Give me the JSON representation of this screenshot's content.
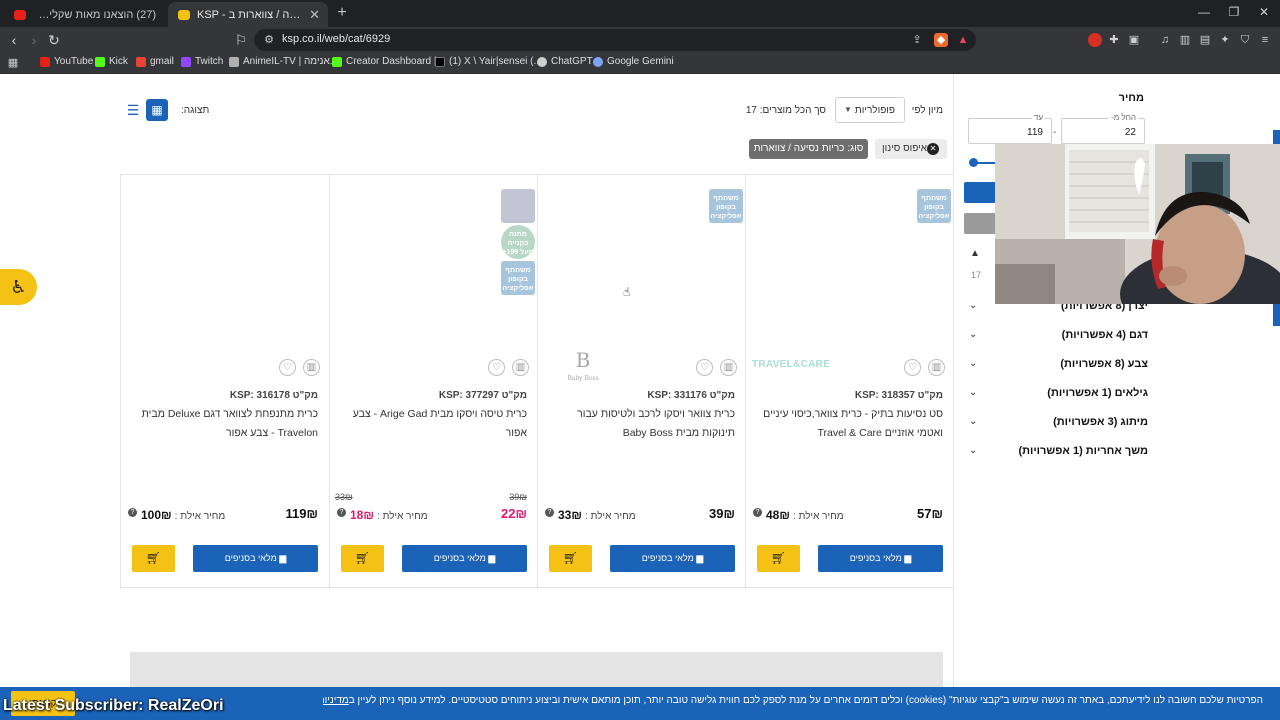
{
  "tabs": [
    {
      "title": "(27) הוצאנו מאות שקלים לבדוק מוצר...",
      "favicon": "youtube-icon",
      "active": false
    },
    {
      "title": "KSP - כריות נסיעה / צווארות ב-",
      "favicon": "ksp-icon",
      "active": true
    }
  ],
  "address_bar": {
    "url": "ksp.co.il/web/cat/6929"
  },
  "bookmarks": [
    {
      "label": "YouTube",
      "icon": "youtube-icon"
    },
    {
      "label": "Kick",
      "icon": "kick-icon"
    },
    {
      "label": "gmail",
      "icon": "gmail-icon"
    },
    {
      "label": "Twitch",
      "icon": "twitch-icon"
    },
    {
      "label": "AnimeIL-TV | אנימה...",
      "icon": "animeil-icon"
    },
    {
      "label": "Creator Dashboard |...",
      "icon": "kick-icon"
    },
    {
      "label": "(1) X \\ Yair|sensei (...",
      "icon": "x-icon"
    },
    {
      "label": "ChatGPT",
      "icon": "chatgpt-icon"
    },
    {
      "label": "Google Gemini",
      "icon": "gemini-icon"
    }
  ],
  "sidebar": {
    "price_title": "מחיר",
    "price_from_label": "החל מ-",
    "price_from_value": "22",
    "price_to_label": "עד",
    "price_to_value": "119",
    "range_dash": "-",
    "count": "17",
    "filters": [
      {
        "label": "יצרן (8 אפשרויות)"
      },
      {
        "label": "דגם (4 אפשרויות)"
      },
      {
        "label": "צבע (8 אפשרויות)"
      },
      {
        "label": "גילאים (1 אפשרויות)"
      },
      {
        "label": "מיתוג (3 אפשרויות)"
      },
      {
        "label": "משך אחריות (1 אפשרויות)"
      }
    ]
  },
  "toolbar": {
    "sort_label": "מיון לפי",
    "sort_value": "פופולריות",
    "total_label": "סך הכל מוצרים: 17",
    "display_label": "תצוגה:",
    "reset_label": "איפוס סינון",
    "active_filter_chip": "סוג: כריות נסיעה / צווארות"
  },
  "products": [
    {
      "sku": "מק\"ט KSP: 318357",
      "name": "סט נסיעות בתיק - כרית צוואר,כיסוי עיניים ואטמי אוזניים Travel & Care",
      "price": "57₪",
      "club_label": "מחיר אילת :",
      "club_price": "48₪",
      "brand_logo": "TRAVEL&CARE",
      "badges": [
        "משתתף בקופון אפליקציה"
      ]
    },
    {
      "sku": "מק\"ט KSP: 331176",
      "name": "כרית צוואר ויסקו לרכב ולטיסות עבור תינוקות מבית Baby Boss",
      "price": "39₪",
      "club_label": "מחיר אילת :",
      "club_price": "33₪",
      "brand_logo": "Baby Boss",
      "badges": [
        "משתתף בקופון אפליקציה"
      ]
    },
    {
      "sku": "מק\"ט KSP: 377297",
      "name": "כרית טיסה ויסקו מבית Arige Gad - צבע אפור",
      "price": "22₪",
      "old_price": "39₪",
      "club_label": "מחיר אילת :",
      "club_price": "18₪",
      "club_old_price": "33₪",
      "sale": true,
      "badges": [
        "",
        "מתנה בקנייה מעל 199+",
        "משתתף בקופון אפליקציה"
      ]
    },
    {
      "sku": "מק\"ט KSP: 316178",
      "name": "כרית מתנפחת לצוואר דגם Deluxe מבית Travelon - צבע אפור",
      "price": "119₪",
      "club_label": "מחיר אילת :",
      "club_price": "100₪",
      "badges": []
    }
  ],
  "buttons": {
    "in_stock_label": "מלאי בסניפים"
  },
  "cookie_bar": {
    "text": "הפרטיות שלכם חשובה לנו לידיעתכם, באתר זה נעשה שימוש ב\"קבצי עוגיות\" (cookies) וכלים דומים אחרים על מנת לספק לכם חווית גלישה טובה יותר, תוכן מותאם אישית וביצוע ניתוחים סטטיסטיים. למידע נוסף ניתן לעיין ב",
    "link_text": "מדיניות הפרטיות שלנו",
    "accept_label": "קראתי"
  },
  "stream_overlay": {
    "text": "Latest Subscriber: RealZeOri"
  },
  "colors": {
    "ksp_blue": "#1b63b8",
    "cart_yellow": "#f4c115",
    "sale_pink": "#e0176b",
    "chrome_dark": "#202124"
  }
}
